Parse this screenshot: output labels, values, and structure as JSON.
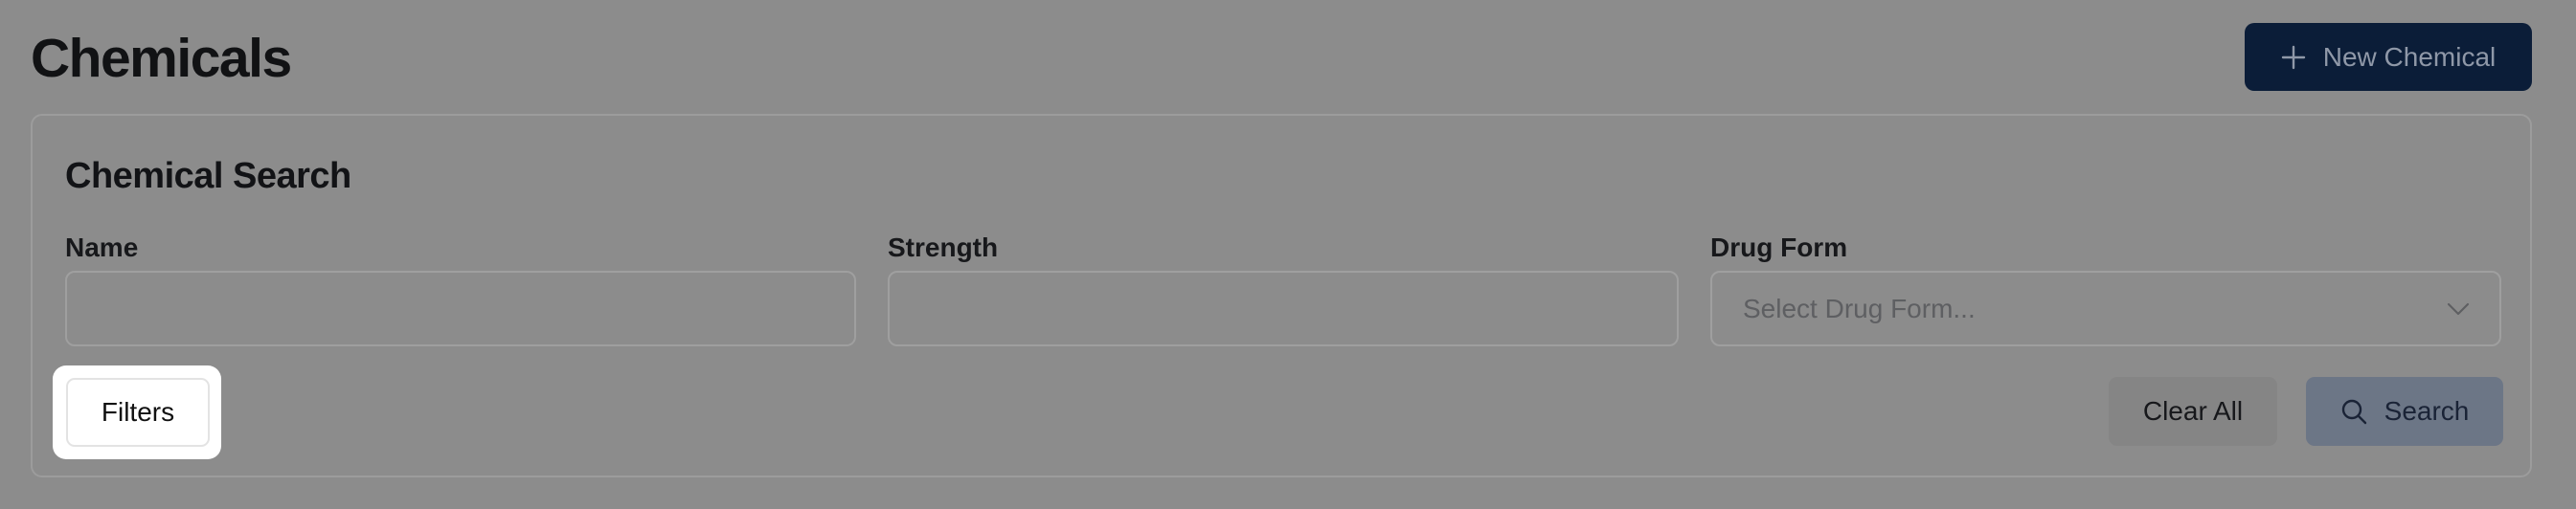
{
  "header": {
    "title": "Chemicals",
    "new_button_label": "New Chemical",
    "new_button_icon": "plus-icon"
  },
  "search_card": {
    "title": "Chemical Search",
    "fields": {
      "name": {
        "label": "Name",
        "value": ""
      },
      "strength": {
        "label": "Strength",
        "value": ""
      },
      "drug_form": {
        "label": "Drug Form",
        "placeholder": "Select Drug Form...",
        "icon": "chevron-down-icon"
      }
    },
    "filters_label": "Filters",
    "clear_label": "Clear All",
    "search_label": "Search",
    "search_icon": "search-icon"
  },
  "colors": {
    "overlay": "#8c8c8c",
    "primary_button": "#0b1d38",
    "highlight": "#ffffff"
  }
}
